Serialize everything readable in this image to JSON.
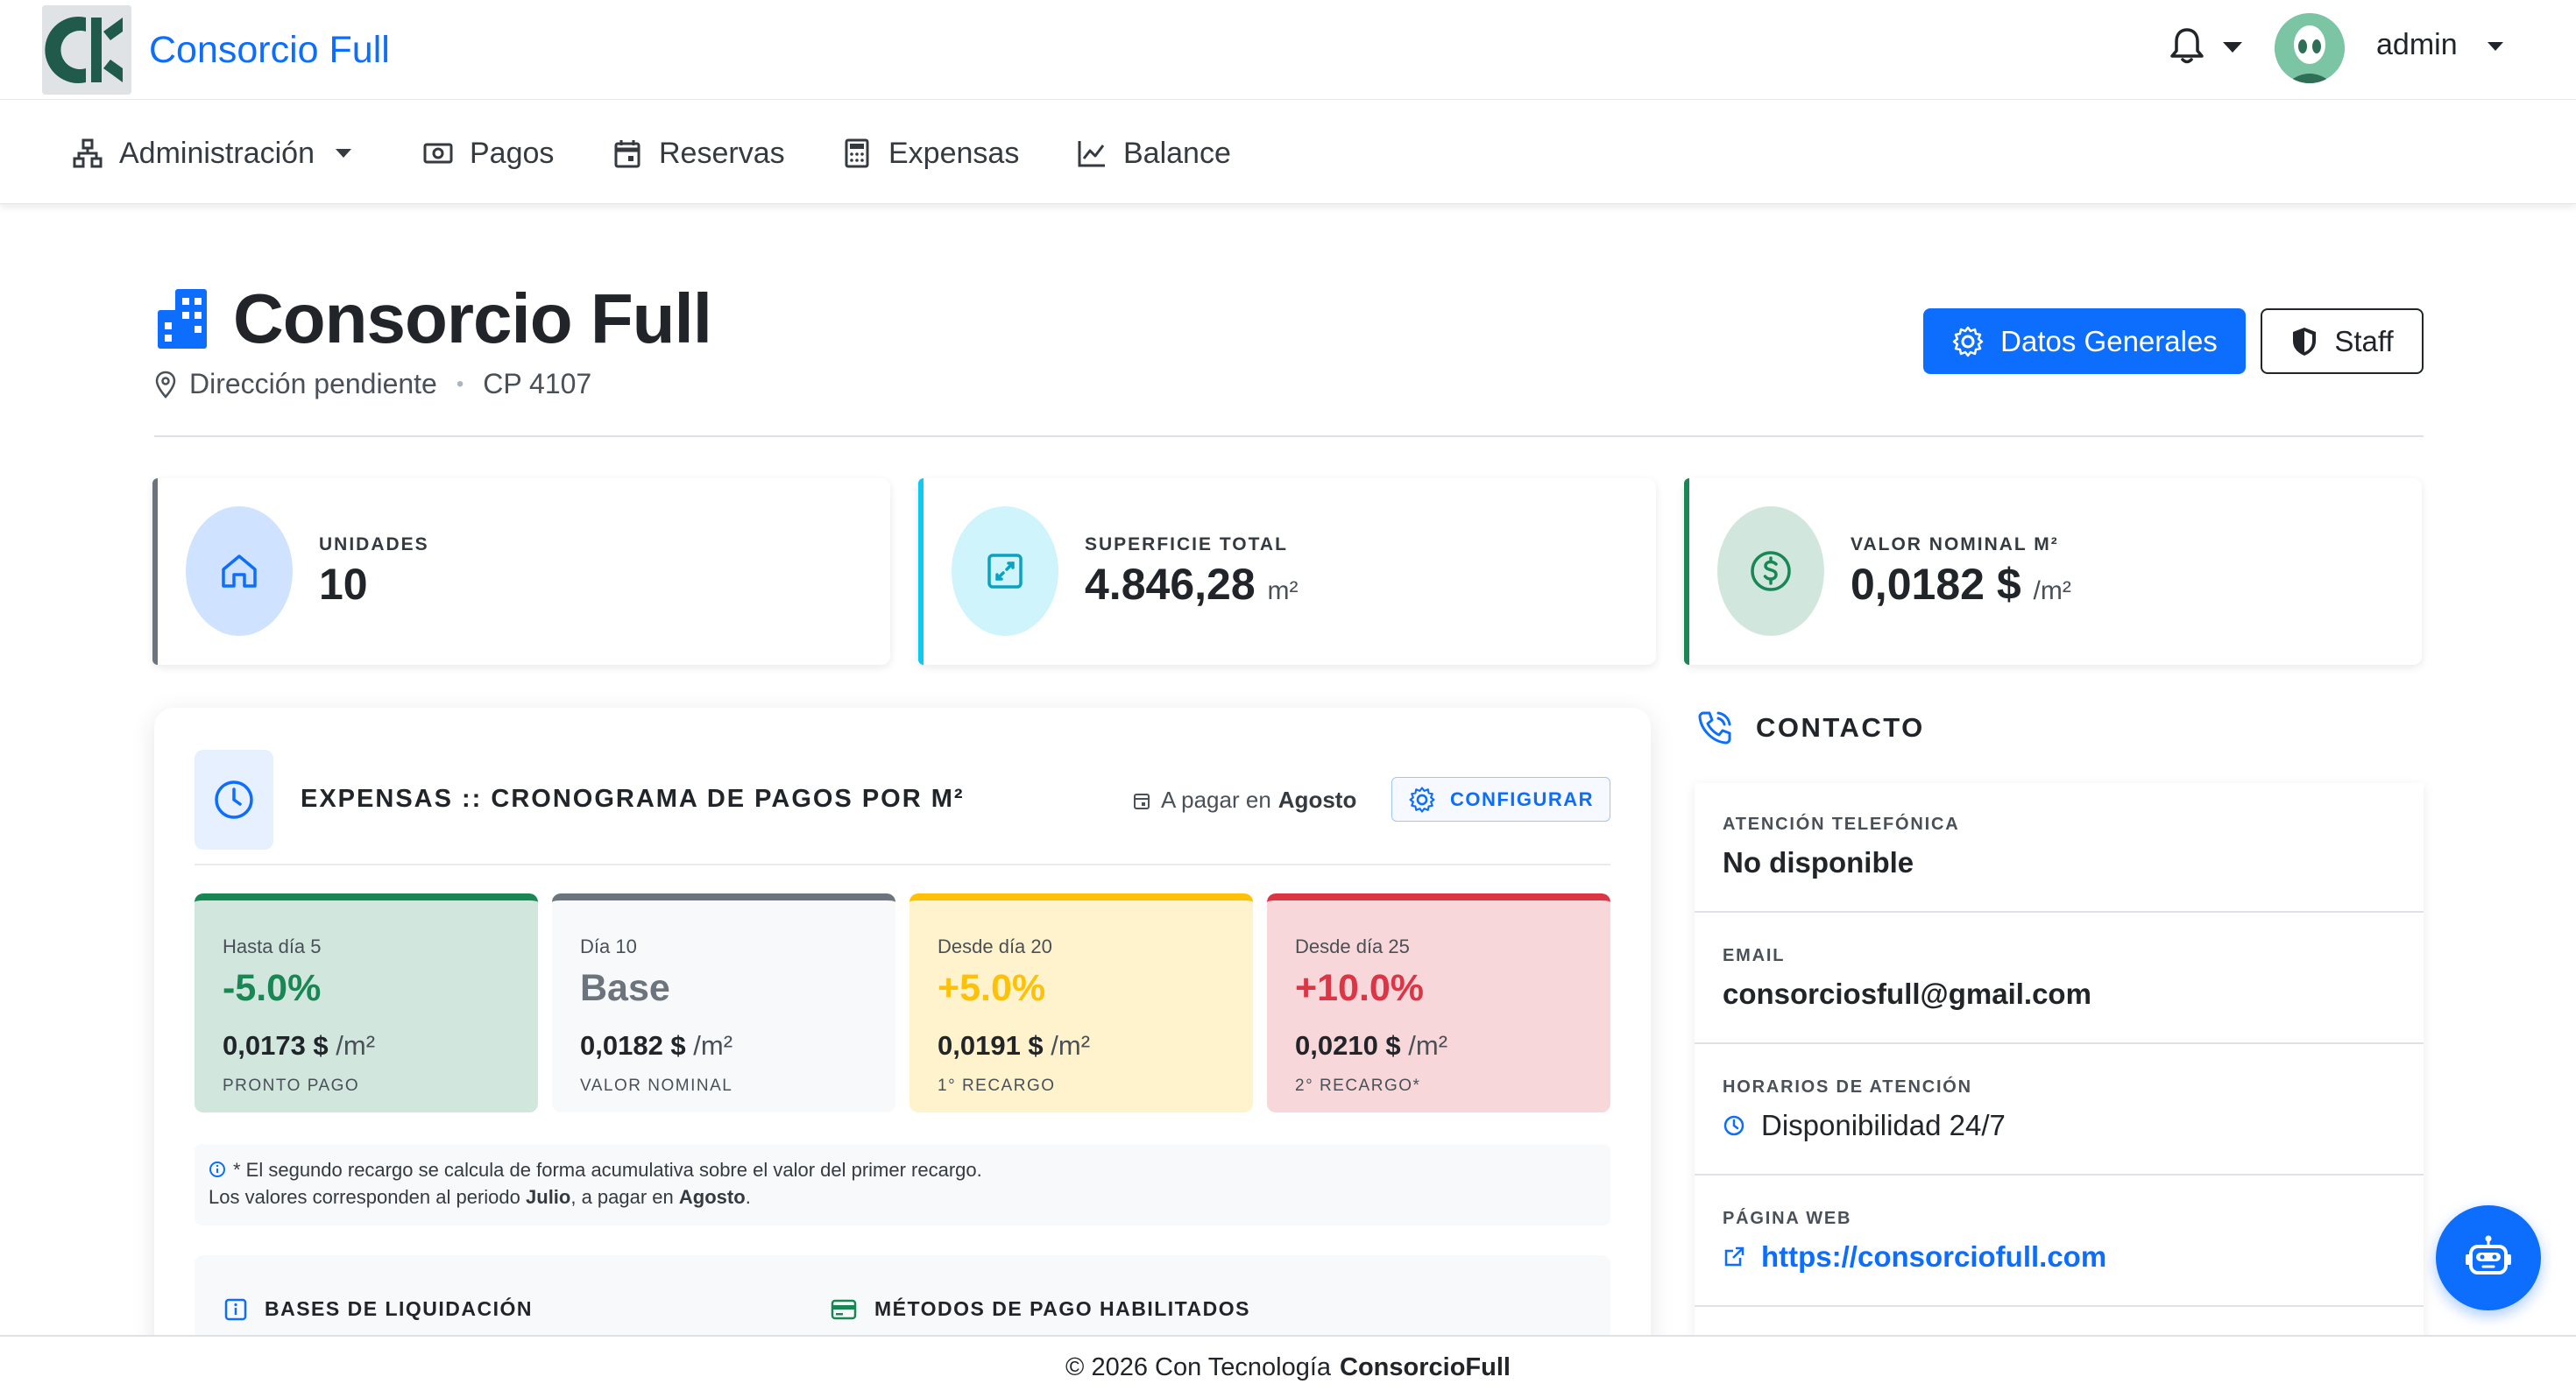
{
  "app": {
    "name": "Consorcio Full",
    "user": "admin"
  },
  "nav": {
    "items": [
      {
        "label": "Administración",
        "icon": "sitemap-icon"
      },
      {
        "label": "Pagos",
        "icon": "money-icon"
      },
      {
        "label": "Reservas",
        "icon": "calendar-icon"
      },
      {
        "label": "Expensas",
        "icon": "calculator-icon"
      },
      {
        "label": "Balance",
        "icon": "chart-line-icon"
      }
    ]
  },
  "header": {
    "title": "Consorcio Full",
    "address": "Dirección pendiente",
    "separator": "•",
    "postal_code": "CP 4107",
    "btn_datos": "Datos Generales",
    "btn_staff": "Staff"
  },
  "stats": [
    {
      "label": "UNIDADES",
      "value": "10",
      "unit": "",
      "color": "#6c757d"
    },
    {
      "label": "SUPERFICIE TOTAL",
      "value": "4.846,28",
      "unit": "m²",
      "color": "#0dcaf0"
    },
    {
      "label": "VALOR NOMINAL M²",
      "value": "0,0182 $",
      "unit": "/m²",
      "color": "#198754"
    }
  ],
  "schedule": {
    "title": "EXPENSAS :: CRONOGRAMA DE PAGOS POR M²",
    "pay_prefix": "A pagar en",
    "pay_month": "Agosto",
    "btn_config": "CONFIGURAR",
    "tiers": [
      {
        "day": "Hasta día 5",
        "pct": "-5.0%",
        "value": "0,0173 $",
        "unit": "/m²",
        "sub": "PRONTO PAGO",
        "bg": "#d1e7dd",
        "border": "#198754",
        "pct_color": "#198754"
      },
      {
        "day": "Día 10",
        "pct": "Base",
        "value": "0,0182 $",
        "unit": "/m²",
        "sub": "VALOR NOMINAL",
        "bg": "#f8f9fa",
        "border": "#6c757d",
        "pct_color": "#6c757d"
      },
      {
        "day": "Desde día 20",
        "pct": "+5.0%",
        "value": "0,0191 $",
        "unit": "/m²",
        "sub": "1° RECARGO",
        "bg": "#fff3cd",
        "border": "#ffc107",
        "pct_color": "#ffc107"
      },
      {
        "day": "Desde día 25",
        "pct": "+10.0%",
        "value": "0,0210 $",
        "unit": "/m²",
        "sub": "2° RECARGO*",
        "bg": "#f8d7da",
        "border": "#dc3545",
        "pct_color": "#dc3545"
      }
    ],
    "note_line1": "* El segundo recargo se calcula de forma acumulativa sobre el valor del primer recargo.",
    "note_l2_a": "Los valores corresponden al periodo",
    "note_l2_period": "Julio",
    "note_l2_b": ", a pagar en",
    "note_l2_month": "Agosto",
    "note_l2_end": ".",
    "bases_title": "BASES DE LIQUIDACIÓN",
    "methods_title": "MÉTODOS DE PAGO HABILITADOS"
  },
  "contact": {
    "title": "CONTACTO",
    "items": [
      {
        "label": "ATENCIÓN TELEFÓNICA",
        "value": "No disponible"
      },
      {
        "label": "EMAIL",
        "value": "consorciosfull@gmail.com"
      },
      {
        "label": "HORARIOS DE ATENCIÓN",
        "value": "Disponibilidad 24/7"
      },
      {
        "label": "PÁGINA WEB",
        "value": "https://consorciofull.com"
      }
    ]
  },
  "footer": {
    "text": "© 2026 Con Tecnología",
    "brand": "ConsorcioFull"
  }
}
